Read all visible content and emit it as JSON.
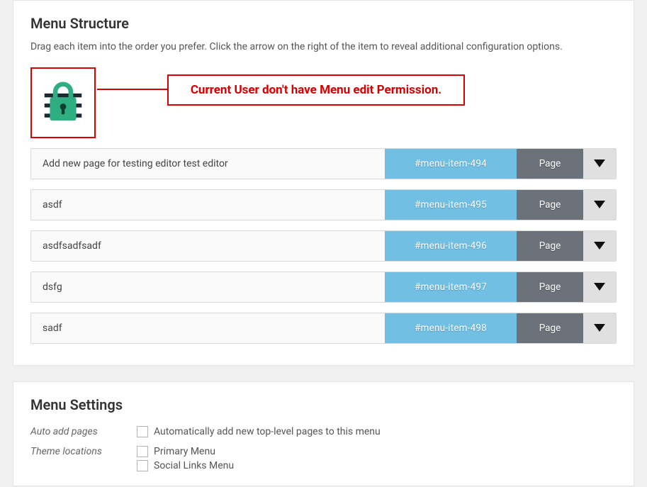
{
  "structure": {
    "title": "Menu Structure",
    "instructions": "Drag each item into the order you prefer. Click the arrow on the right of the item to reveal additional configuration options.",
    "permission_warning": "Current User don't have Menu edit Permission."
  },
  "menu_items": [
    {
      "title": "Add new page for testing editor test editor",
      "id": "#menu-item-494",
      "type": "Page"
    },
    {
      "title": "asdf",
      "id": "#menu-item-495",
      "type": "Page"
    },
    {
      "title": "asdfsadfsadf",
      "id": "#menu-item-496",
      "type": "Page"
    },
    {
      "title": "dsfg",
      "id": "#menu-item-497",
      "type": "Page"
    },
    {
      "title": "sadf",
      "id": "#menu-item-498",
      "type": "Page"
    }
  ],
  "settings": {
    "title": "Menu Settings",
    "auto_add_label": "Auto add pages",
    "auto_add_option": "Automatically add new top-level pages to this menu",
    "theme_loc_label": "Theme locations",
    "theme_loc_options": [
      "Primary Menu",
      "Social Links Menu"
    ]
  }
}
